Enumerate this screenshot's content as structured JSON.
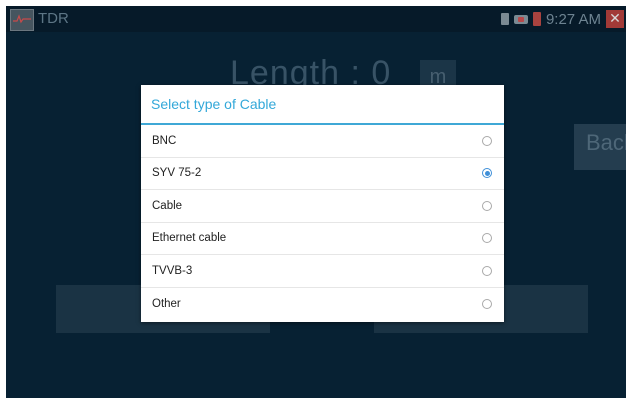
{
  "statusbar": {
    "app_icon": "tdr-app-icon",
    "app_title": "TDR",
    "clock": "9:27 AM",
    "close_symbol": "✕"
  },
  "main": {
    "length_label": "Length : 0",
    "length_unit": "m",
    "back_label": "Back"
  },
  "dialog": {
    "title": "Select type of Cable",
    "accent_color": "#3fa8d6",
    "options": [
      {
        "label": "BNC",
        "selected": false
      },
      {
        "label": "SYV 75-2",
        "selected": true
      },
      {
        "label": "Cable",
        "selected": false
      },
      {
        "label": "Ethernet cable",
        "selected": false
      },
      {
        "label": "TVVB-3",
        "selected": false
      },
      {
        "label": "Other",
        "selected": false
      }
    ]
  }
}
